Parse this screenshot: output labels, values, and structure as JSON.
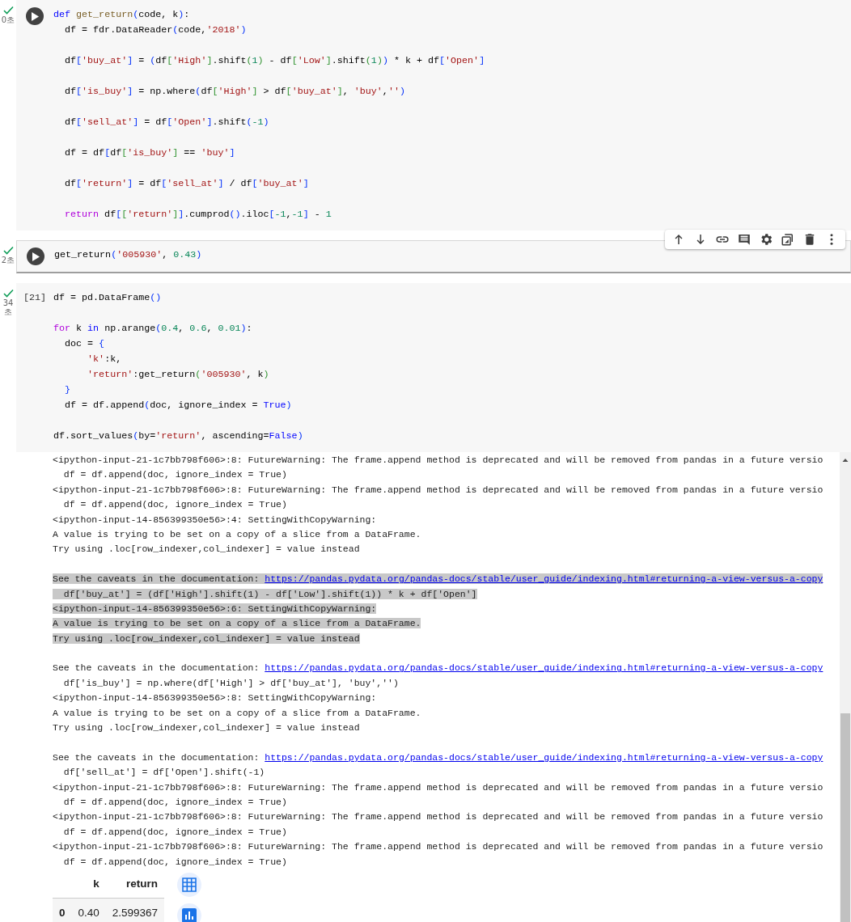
{
  "cells": [
    {
      "completed": true,
      "time": "0초",
      "run_button": true,
      "focused": false,
      "code": [
        {
          "kind": "code",
          "tokens": [
            {
              "kind": "kw",
              "text": "def "
            },
            {
              "kind": "fn",
              "text": "get_return"
            },
            {
              "kind": "b1",
              "text": "("
            },
            {
              "kind": "p",
              "text": "code, k"
            },
            {
              "kind": "b1",
              "text": ")"
            },
            {
              "kind": "p",
              "text": ":"
            }
          ]
        },
        {
          "kind": "code",
          "tokens": [
            {
              "kind": "p",
              "text": "  df = fdr.DataReader"
            },
            {
              "kind": "b1",
              "text": "("
            },
            {
              "kind": "p",
              "text": "code,"
            },
            {
              "kind": "str",
              "text": "'2018'"
            },
            {
              "kind": "b1",
              "text": ")"
            }
          ]
        },
        {
          "kind": "blank"
        },
        {
          "kind": "code",
          "tokens": [
            {
              "kind": "p",
              "text": "  df"
            },
            {
              "kind": "b1",
              "text": "["
            },
            {
              "kind": "str",
              "text": "'buy_at'"
            },
            {
              "kind": "b1",
              "text": "]"
            },
            {
              "kind": "p",
              "text": " = "
            },
            {
              "kind": "b1",
              "text": "("
            },
            {
              "kind": "p",
              "text": "df"
            },
            {
              "kind": "b2",
              "text": "["
            },
            {
              "kind": "str",
              "text": "'High'"
            },
            {
              "kind": "b2",
              "text": "]"
            },
            {
              "kind": "p",
              "text": ".shift"
            },
            {
              "kind": "b2",
              "text": "("
            },
            {
              "kind": "num",
              "text": "1"
            },
            {
              "kind": "b2",
              "text": ")"
            },
            {
              "kind": "p",
              "text": " - df"
            },
            {
              "kind": "b2",
              "text": "["
            },
            {
              "kind": "str",
              "text": "'Low'"
            },
            {
              "kind": "b2",
              "text": "]"
            },
            {
              "kind": "p",
              "text": ".shift"
            },
            {
              "kind": "b2",
              "text": "("
            },
            {
              "kind": "num",
              "text": "1"
            },
            {
              "kind": "b2",
              "text": ")"
            },
            {
              "kind": "b1",
              "text": ")"
            },
            {
              "kind": "p",
              "text": " * k + df"
            },
            {
              "kind": "b1",
              "text": "["
            },
            {
              "kind": "str",
              "text": "'Open'"
            },
            {
              "kind": "b1",
              "text": "]"
            }
          ]
        },
        {
          "kind": "blank"
        },
        {
          "kind": "code",
          "tokens": [
            {
              "kind": "p",
              "text": "  df"
            },
            {
              "kind": "b1",
              "text": "["
            },
            {
              "kind": "str",
              "text": "'is_buy'"
            },
            {
              "kind": "b1",
              "text": "]"
            },
            {
              "kind": "p",
              "text": " = np.where"
            },
            {
              "kind": "b1",
              "text": "("
            },
            {
              "kind": "p",
              "text": "df"
            },
            {
              "kind": "b2",
              "text": "["
            },
            {
              "kind": "str",
              "text": "'High'"
            },
            {
              "kind": "b2",
              "text": "]"
            },
            {
              "kind": "p",
              "text": " > df"
            },
            {
              "kind": "b2",
              "text": "["
            },
            {
              "kind": "str",
              "text": "'buy_at'"
            },
            {
              "kind": "b2",
              "text": "]"
            },
            {
              "kind": "p",
              "text": ", "
            },
            {
              "kind": "str",
              "text": "'buy'"
            },
            {
              "kind": "p",
              "text": ","
            },
            {
              "kind": "str",
              "text": "''"
            },
            {
              "kind": "b1",
              "text": ")"
            }
          ]
        },
        {
          "kind": "blank"
        },
        {
          "kind": "code",
          "tokens": [
            {
              "kind": "p",
              "text": "  df"
            },
            {
              "kind": "b1",
              "text": "["
            },
            {
              "kind": "str",
              "text": "'sell_at'"
            },
            {
              "kind": "b1",
              "text": "]"
            },
            {
              "kind": "p",
              "text": " = df"
            },
            {
              "kind": "b1",
              "text": "["
            },
            {
              "kind": "str",
              "text": "'Open'"
            },
            {
              "kind": "b1",
              "text": "]"
            },
            {
              "kind": "p",
              "text": ".shift"
            },
            {
              "kind": "b1",
              "text": "("
            },
            {
              "kind": "num",
              "text": "-1"
            },
            {
              "kind": "b1",
              "text": ")"
            }
          ]
        },
        {
          "kind": "blank"
        },
        {
          "kind": "code",
          "tokens": [
            {
              "kind": "p",
              "text": "  df = df"
            },
            {
              "kind": "b1",
              "text": "["
            },
            {
              "kind": "p",
              "text": "df"
            },
            {
              "kind": "b2",
              "text": "["
            },
            {
              "kind": "str",
              "text": "'is_buy'"
            },
            {
              "kind": "b2",
              "text": "]"
            },
            {
              "kind": "p",
              "text": " == "
            },
            {
              "kind": "str",
              "text": "'buy'"
            },
            {
              "kind": "b1",
              "text": "]"
            }
          ]
        },
        {
          "kind": "blank"
        },
        {
          "kind": "code",
          "tokens": [
            {
              "kind": "p",
              "text": "  df"
            },
            {
              "kind": "b1",
              "text": "["
            },
            {
              "kind": "str",
              "text": "'return'"
            },
            {
              "kind": "b1",
              "text": "]"
            },
            {
              "kind": "p",
              "text": " = df"
            },
            {
              "kind": "b1",
              "text": "["
            },
            {
              "kind": "str",
              "text": "'sell_at'"
            },
            {
              "kind": "b1",
              "text": "]"
            },
            {
              "kind": "p",
              "text": " / df"
            },
            {
              "kind": "b1",
              "text": "["
            },
            {
              "kind": "str",
              "text": "'buy_at'"
            },
            {
              "kind": "b1",
              "text": "]"
            }
          ]
        },
        {
          "kind": "blank"
        },
        {
          "kind": "code",
          "tokens": [
            {
              "kind": "ctrl",
              "text": "  return"
            },
            {
              "kind": "p",
              "text": " df"
            },
            {
              "kind": "b1",
              "text": "["
            },
            {
              "kind": "b2",
              "text": "["
            },
            {
              "kind": "str",
              "text": "'return'"
            },
            {
              "kind": "b2",
              "text": "]"
            },
            {
              "kind": "b1",
              "text": "]"
            },
            {
              "kind": "p",
              "text": ".cumprod"
            },
            {
              "kind": "b1",
              "text": "()"
            },
            {
              "kind": "p",
              "text": ".iloc"
            },
            {
              "kind": "b1",
              "text": "["
            },
            {
              "kind": "num",
              "text": "-1"
            },
            {
              "kind": "p",
              "text": ","
            },
            {
              "kind": "num",
              "text": "-1"
            },
            {
              "kind": "b1",
              "text": "]"
            },
            {
              "kind": "p",
              "text": " - "
            },
            {
              "kind": "num",
              "text": "1"
            }
          ]
        }
      ]
    },
    {
      "completed": true,
      "time": "2초",
      "run_button": true,
      "focused": true,
      "code": [
        {
          "kind": "code",
          "tokens": [
            {
              "kind": "p",
              "text": "get_return"
            },
            {
              "kind": "b1",
              "text": "("
            },
            {
              "kind": "str",
              "text": "'005930'"
            },
            {
              "kind": "p",
              "text": ", "
            },
            {
              "kind": "num",
              "text": "0.43"
            },
            {
              "kind": "b1",
              "text": ")"
            }
          ]
        }
      ]
    },
    {
      "completed": true,
      "time": "34초",
      "execution_count": "[21]",
      "focused": false,
      "code": [
        {
          "kind": "code",
          "tokens": [
            {
              "kind": "p",
              "text": "df = pd.DataFrame"
            },
            {
              "kind": "b1",
              "text": "()"
            }
          ]
        },
        {
          "kind": "blank"
        },
        {
          "kind": "code",
          "tokens": [
            {
              "kind": "ctrl",
              "text": "for"
            },
            {
              "kind": "p",
              "text": " k "
            },
            {
              "kind": "kw",
              "text": "in"
            },
            {
              "kind": "p",
              "text": " np.arange"
            },
            {
              "kind": "b1",
              "text": "("
            },
            {
              "kind": "num",
              "text": "0.4"
            },
            {
              "kind": "p",
              "text": ", "
            },
            {
              "kind": "num",
              "text": "0.6"
            },
            {
              "kind": "p",
              "text": ", "
            },
            {
              "kind": "num",
              "text": "0.01"
            },
            {
              "kind": "b1",
              "text": ")"
            },
            {
              "kind": "p",
              "text": ":"
            }
          ]
        },
        {
          "kind": "code",
          "tokens": [
            {
              "kind": "p",
              "text": "  doc = "
            },
            {
              "kind": "b1",
              "text": "{"
            }
          ]
        },
        {
          "kind": "code",
          "tokens": [
            {
              "kind": "str",
              "text": "      'k'"
            },
            {
              "kind": "p",
              "text": ":k,"
            }
          ]
        },
        {
          "kind": "code",
          "tokens": [
            {
              "kind": "str",
              "text": "      'return'"
            },
            {
              "kind": "p",
              "text": ":get_return"
            },
            {
              "kind": "b2",
              "text": "("
            },
            {
              "kind": "str",
              "text": "'005930'"
            },
            {
              "kind": "p",
              "text": ", k"
            },
            {
              "kind": "b2",
              "text": ")"
            }
          ]
        },
        {
          "kind": "code",
          "tokens": [
            {
              "kind": "b1",
              "text": "  }"
            }
          ]
        },
        {
          "kind": "code",
          "tokens": [
            {
              "kind": "p",
              "text": "  df = df.append"
            },
            {
              "kind": "b1",
              "text": "("
            },
            {
              "kind": "p",
              "text": "doc, ignore_index = "
            },
            {
              "kind": "kw",
              "text": "True"
            },
            {
              "kind": "b1",
              "text": ")"
            }
          ]
        },
        {
          "kind": "blank"
        },
        {
          "kind": "code",
          "tokens": [
            {
              "kind": "p",
              "text": "df.sort_values"
            },
            {
              "kind": "b1",
              "text": "("
            },
            {
              "kind": "p",
              "text": "by="
            },
            {
              "kind": "str",
              "text": "'return'"
            },
            {
              "kind": "p",
              "text": ", ascending="
            },
            {
              "kind": "kw",
              "text": "False"
            },
            {
              "kind": "b1",
              "text": ")"
            }
          ]
        }
      ],
      "output": {
        "lines": [
          {
            "kind": "text",
            "text": "<ipython-input-21-1c7bb798f606>:8: FutureWarning: The frame.append method is deprecated and will be removed from pandas in a future versio",
            "selected": false
          },
          {
            "kind": "text",
            "text": "  df = df.append(doc, ignore_index = True)",
            "selected": false
          },
          {
            "kind": "text",
            "text": "<ipython-input-21-1c7bb798f606>:8: FutureWarning: The frame.append method is deprecated and will be removed from pandas in a future versio",
            "selected": false
          },
          {
            "kind": "text",
            "text": "  df = df.append(doc, ignore_index = True)",
            "selected": false
          },
          {
            "kind": "text",
            "text": "<ipython-input-14-856399350e56>:4: SettingWithCopyWarning:",
            "selected": false
          },
          {
            "kind": "text",
            "text": "A value is trying to be set on a copy of a slice from a DataFrame.",
            "selected": false
          },
          {
            "kind": "text",
            "text": "Try using .loc[row_indexer,col_indexer] = value instead",
            "selected": false
          },
          {
            "kind": "blank"
          },
          {
            "kind": "link",
            "text": "See the caveats in the documentation: ",
            "link": "https://pandas.pydata.org/pandas-docs/stable/user_guide/indexing.html#returning-a-view-versus-a-copy",
            "selected": true
          },
          {
            "kind": "text",
            "text": "  df['buy_at'] = (df['High'].shift(1) - df['Low'].shift(1)) * k + df['Open']",
            "selected": true
          },
          {
            "kind": "text",
            "text": "<ipython-input-14-856399350e56>:6: SettingWithCopyWarning:",
            "selected": true
          },
          {
            "kind": "text",
            "text": "A value is trying to be set on a copy of a slice from a DataFrame.",
            "selected": true
          },
          {
            "kind": "text",
            "text": "Try using .loc[row_indexer,col_indexer] = value instead",
            "selected": true
          },
          {
            "kind": "blank"
          },
          {
            "kind": "link",
            "text": "See the caveats in the documentation: ",
            "link": "https://pandas.pydata.org/pandas-docs/stable/user_guide/indexing.html#returning-a-view-versus-a-copy",
            "selected": false
          },
          {
            "kind": "text",
            "text": "  df['is_buy'] = np.where(df['High'] > df['buy_at'], 'buy','')",
            "selected": false
          },
          {
            "kind": "text",
            "text": "<ipython-input-14-856399350e56>:8: SettingWithCopyWarning:",
            "selected": false
          },
          {
            "kind": "text",
            "text": "A value is trying to be set on a copy of a slice from a DataFrame.",
            "selected": false
          },
          {
            "kind": "text",
            "text": "Try using .loc[row_indexer,col_indexer] = value instead",
            "selected": false
          },
          {
            "kind": "blank"
          },
          {
            "kind": "link",
            "text": "See the caveats in the documentation: ",
            "link": "https://pandas.pydata.org/pandas-docs/stable/user_guide/indexing.html#returning-a-view-versus-a-copy",
            "selected": false
          },
          {
            "kind": "text",
            "text": "  df['sell_at'] = df['Open'].shift(-1)",
            "selected": false
          },
          {
            "kind": "text",
            "text": "<ipython-input-21-1c7bb798f606>:8: FutureWarning: The frame.append method is deprecated and will be removed from pandas in a future versio",
            "selected": false
          },
          {
            "kind": "text",
            "text": "  df = df.append(doc, ignore_index = True)",
            "selected": false
          },
          {
            "kind": "text",
            "text": "<ipython-input-21-1c7bb798f606>:8: FutureWarning: The frame.append method is deprecated and will be removed from pandas in a future versio",
            "selected": false
          },
          {
            "kind": "text",
            "text": "  df = df.append(doc, ignore_index = True)",
            "selected": false
          },
          {
            "kind": "text",
            "text": "<ipython-input-21-1c7bb798f606>:8: FutureWarning: The frame.append method is deprecated and will be removed from pandas in a future versio",
            "selected": false
          },
          {
            "kind": "text",
            "text": "  df = df.append(doc, ignore_index = True)",
            "selected": false
          }
        ],
        "table": {
          "columns": [
            "k",
            "return"
          ],
          "rows": [
            {
              "index": "0",
              "cells": [
                "0.40",
                "2.599367"
              ]
            }
          ]
        }
      }
    }
  ]
}
